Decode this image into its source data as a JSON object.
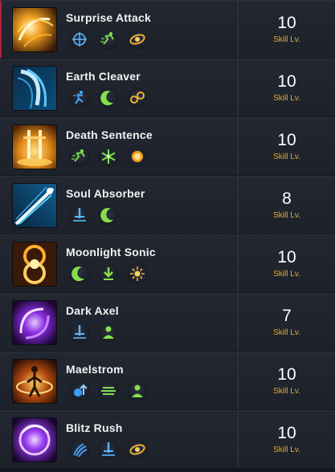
{
  "level_label": "Skill Lv.",
  "colors": {
    "selected_accent": "#b3203a",
    "level_label": "#e0b02c"
  },
  "skills": [
    {
      "name": "Surprise Attack",
      "level": "10",
      "icon": "surprise-attack-icon",
      "tags": [
        "target-icon",
        "dash-icon",
        "orbit-icon"
      ]
    },
    {
      "name": "Earth Cleaver",
      "level": "10",
      "icon": "earth-cleaver-icon",
      "tags": [
        "sprint-icon",
        "crescent-icon",
        "chain-icon"
      ]
    },
    {
      "name": "Death Sentence",
      "level": "10",
      "icon": "death-sentence-icon",
      "tags": [
        "dash-icon",
        "snowflake-icon",
        "fist-icon"
      ]
    },
    {
      "name": "Soul Absorber",
      "level": "8",
      "icon": "soul-absorber-icon",
      "tags": [
        "sword-icon",
        "crescent-icon"
      ]
    },
    {
      "name": "Moonlight Sonic",
      "level": "10",
      "icon": "moonlight-sonic-icon",
      "tags": [
        "crescent-icon",
        "down-arrow-icon",
        "burst-icon"
      ]
    },
    {
      "name": "Dark Axel",
      "level": "7",
      "icon": "dark-axel-icon",
      "tags": [
        "sword-icon",
        "person-icon"
      ]
    },
    {
      "name": "Maelstrom",
      "level": "10",
      "icon": "maelstrom-icon",
      "tags": [
        "up-arrow-icon",
        "speed-icon",
        "person-icon"
      ]
    },
    {
      "name": "Blitz Rush",
      "level": "10",
      "icon": "blitz-rush-icon",
      "tags": [
        "claw-icon",
        "sword-icon",
        "orbit-icon"
      ]
    }
  ]
}
